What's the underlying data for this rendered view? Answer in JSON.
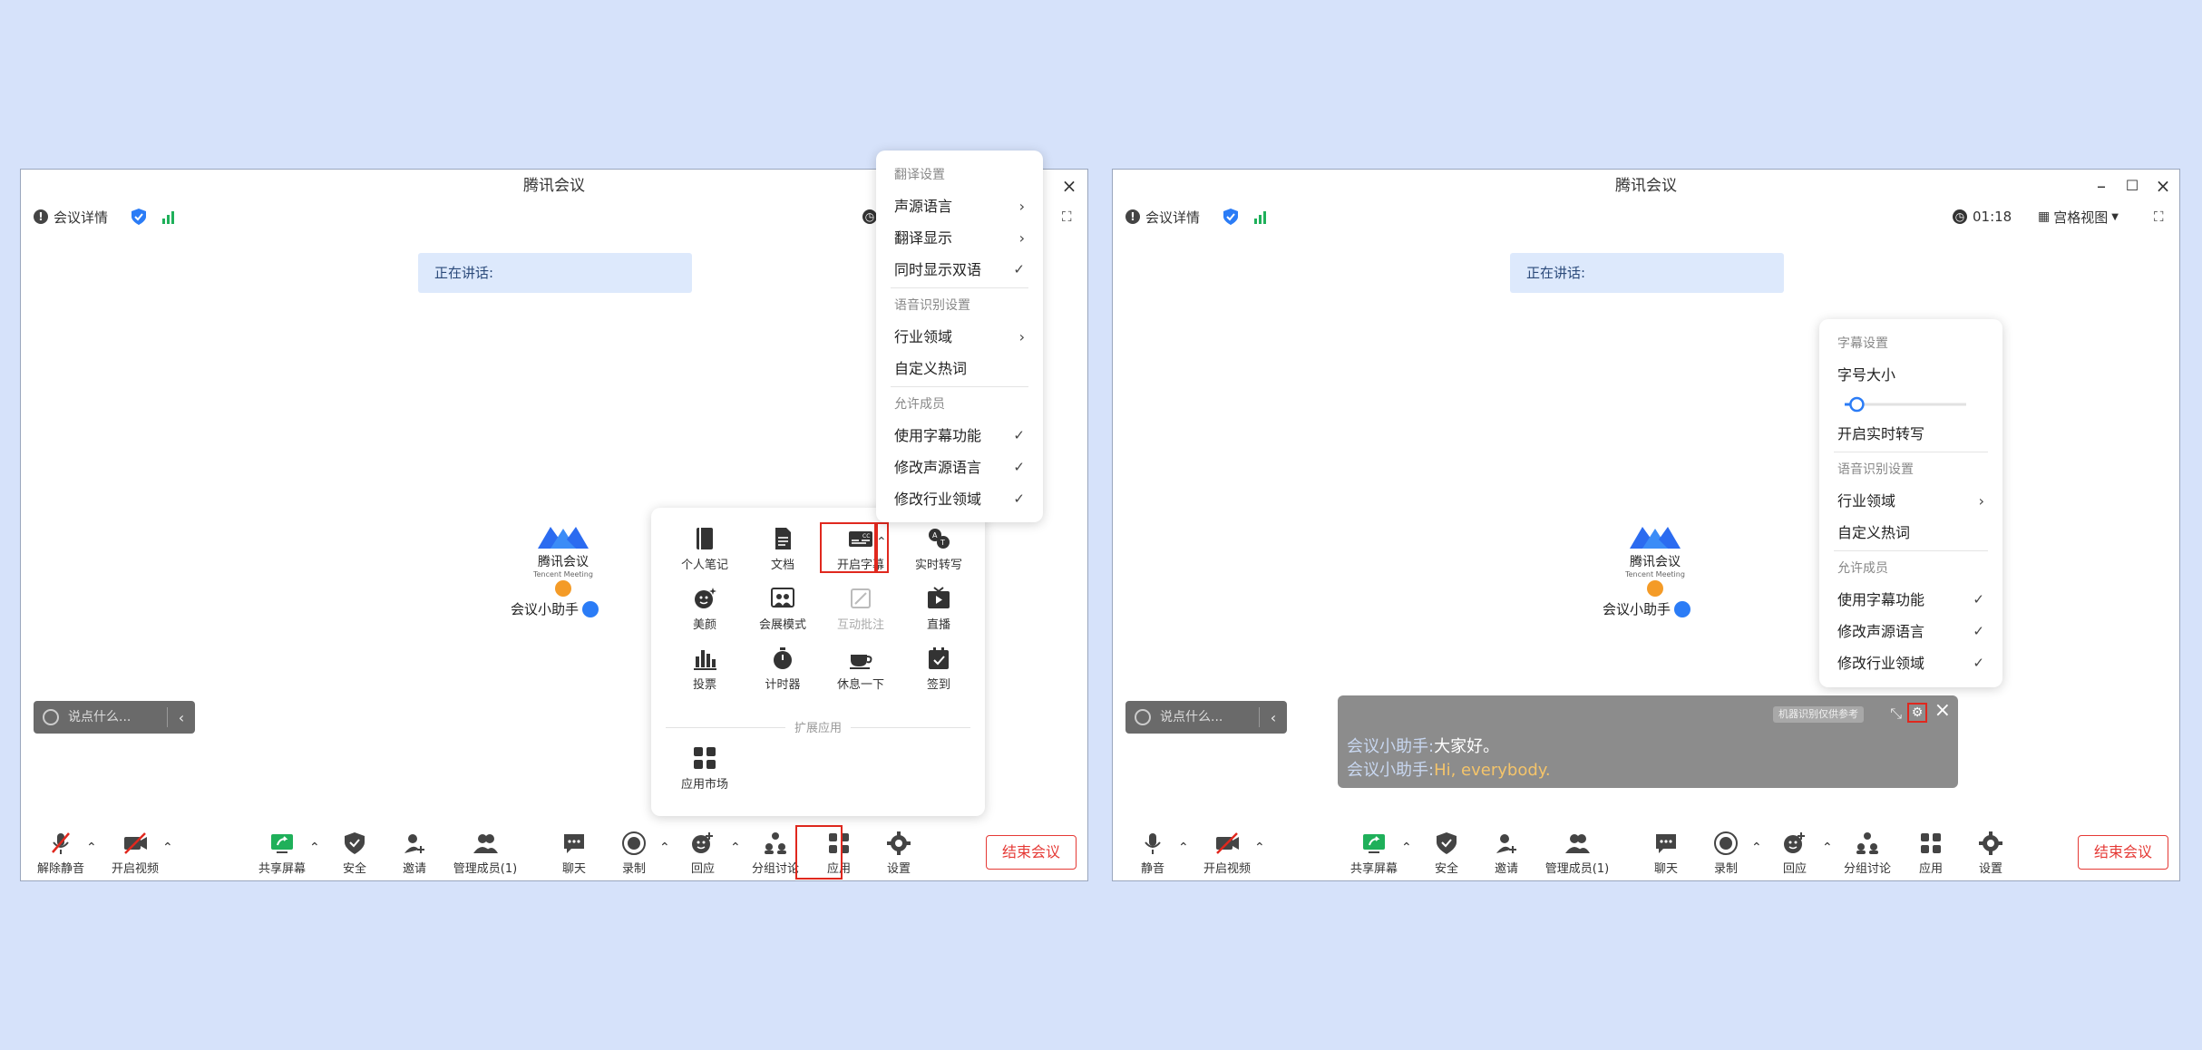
{
  "left_window": {
    "title": "腾讯会议",
    "info": "会议详情",
    "speaking": "正在讲话:",
    "logo_text": "腾讯会议",
    "logo_sub": "Tencent Meeting",
    "assistant": "会议小助手",
    "chat_placeholder": "说点什么...",
    "toolbar": {
      "mute": "解除静音",
      "video": "开启视频",
      "share": "共享屏幕",
      "security": "安全",
      "invite": "邀请",
      "members": "管理成员(1)",
      "chat": "聊天",
      "record": "录制",
      "reaction": "回应",
      "breakout": "分组讨论",
      "apps": "应用",
      "settings": "设置"
    },
    "end_meeting": "结束会议",
    "apps_panel": {
      "apps": [
        {
          "label": "个人笔记",
          "icon": "notebook-icon"
        },
        {
          "label": "文档",
          "icon": "document-icon"
        },
        {
          "label": "开启字幕",
          "icon": "caption-icon"
        },
        {
          "label": "实时转写",
          "icon": "transcribe-icon"
        },
        {
          "label": "美颜",
          "icon": "beauty-icon"
        },
        {
          "label": "会展模式",
          "icon": "exhibition-icon"
        },
        {
          "label": "互动批注",
          "icon": "annotate-icon"
        },
        {
          "label": "直播",
          "icon": "live-icon"
        },
        {
          "label": "投票",
          "icon": "vote-icon"
        },
        {
          "label": "计时器",
          "icon": "timer-icon"
        },
        {
          "label": "休息一下",
          "icon": "coffee-icon"
        },
        {
          "label": "签到",
          "icon": "checkin-icon"
        }
      ],
      "extension_title": "扩展应用",
      "market": "应用市场"
    },
    "caption_menu": {
      "translation_section": "翻译设置",
      "source_language": "声源语言",
      "translation_display": "翻译显示",
      "bilingual": "同时显示双语",
      "recognition_section": "语音识别设置",
      "industry": "行业领域",
      "custom_hotwords": "自定义热词",
      "allow_section": "允许成员",
      "use_caption": "使用字幕功能",
      "modify_source": "修改声源语言",
      "modify_industry": "修改行业领域"
    }
  },
  "right_window": {
    "title": "腾讯会议",
    "info": "会议详情",
    "timer": "01:18",
    "view": "宫格视图",
    "speaking": "正在讲话:",
    "logo_text": "腾讯会议",
    "logo_sub": "Tencent Meeting",
    "assistant": "会议小助手",
    "chat_placeholder": "说点什么...",
    "toolbar": {
      "mute": "静音",
      "video": "开启视频",
      "share": "共享屏幕",
      "security": "安全",
      "invite": "邀请",
      "members": "管理成员(1)",
      "chat": "聊天",
      "record": "录制",
      "reaction": "回应",
      "breakout": "分组讨论",
      "apps": "应用",
      "settings": "设置"
    },
    "end_meeting": "结束会议",
    "subtitle_menu": {
      "subtitle_section": "字幕设置",
      "font_size": "字号大小",
      "font_size_level": 0.1,
      "enable_transcription": "开启实时转写",
      "recognition_section": "语音识别设置",
      "industry": "行业领域",
      "custom_hotwords": "自定义热词",
      "allow_section": "允许成员",
      "use_caption": "使用字幕功能",
      "modify_source": "修改声源语言",
      "modify_industry": "修改行业领域"
    },
    "caption": {
      "tag": "机器识别仅供参考",
      "speaker": "会议小助手:",
      "line_zh": "大家好。",
      "line_en": "Hi, everybody."
    }
  },
  "colors": {
    "background": "#d6e2fa",
    "highlight": "#e0281e",
    "accent": "#2b7cf6",
    "signal": "#1fb05a",
    "end": "#e53935"
  }
}
